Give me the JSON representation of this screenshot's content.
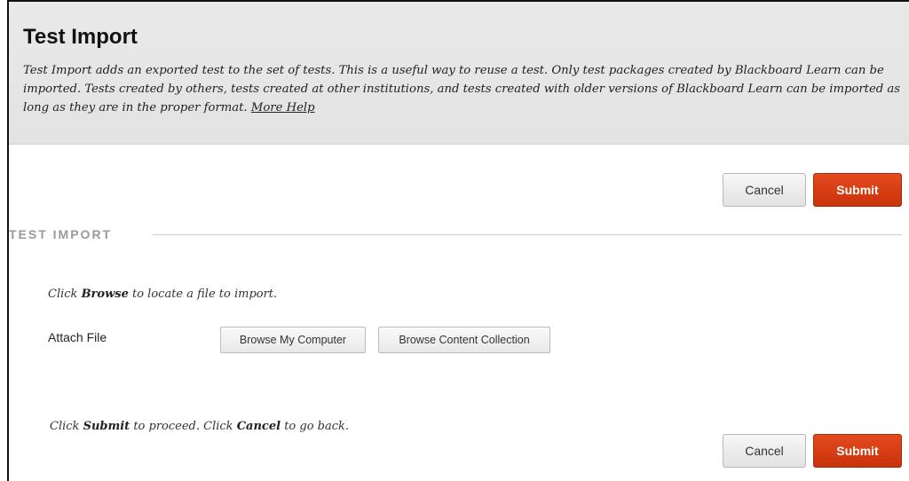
{
  "header": {
    "title": "Test Import",
    "description": "Test Import adds an exported test to the set of tests. This is a useful way to reuse a test. Only test packages created by Blackboard Learn can be imported. Tests created by others, tests created at other institutions, and tests created with older versions of Blackboard Learn can be imported as long as they are in the proper format.",
    "more_help": "More Help"
  },
  "actions_top": {
    "cancel": "Cancel",
    "submit": "Submit"
  },
  "section": {
    "title": "TEST IMPORT",
    "instruction_pre": "Click ",
    "instruction_bold": "Browse",
    "instruction_post": " to locate a file to import.",
    "attach_label": "Attach File",
    "browse_computer": "Browse My Computer",
    "browse_collection": "Browse Content Collection"
  },
  "footer": {
    "pre1": "Click ",
    "bold1": "Submit",
    "mid": " to proceed. Click ",
    "bold2": "Cancel",
    "post": " to go back."
  },
  "actions_bottom": {
    "cancel": "Cancel",
    "submit": "Submit"
  },
  "colors": {
    "submit": "#d9411a",
    "header_bg": "#e6e6e6",
    "section_label": "#9a9a9a"
  }
}
